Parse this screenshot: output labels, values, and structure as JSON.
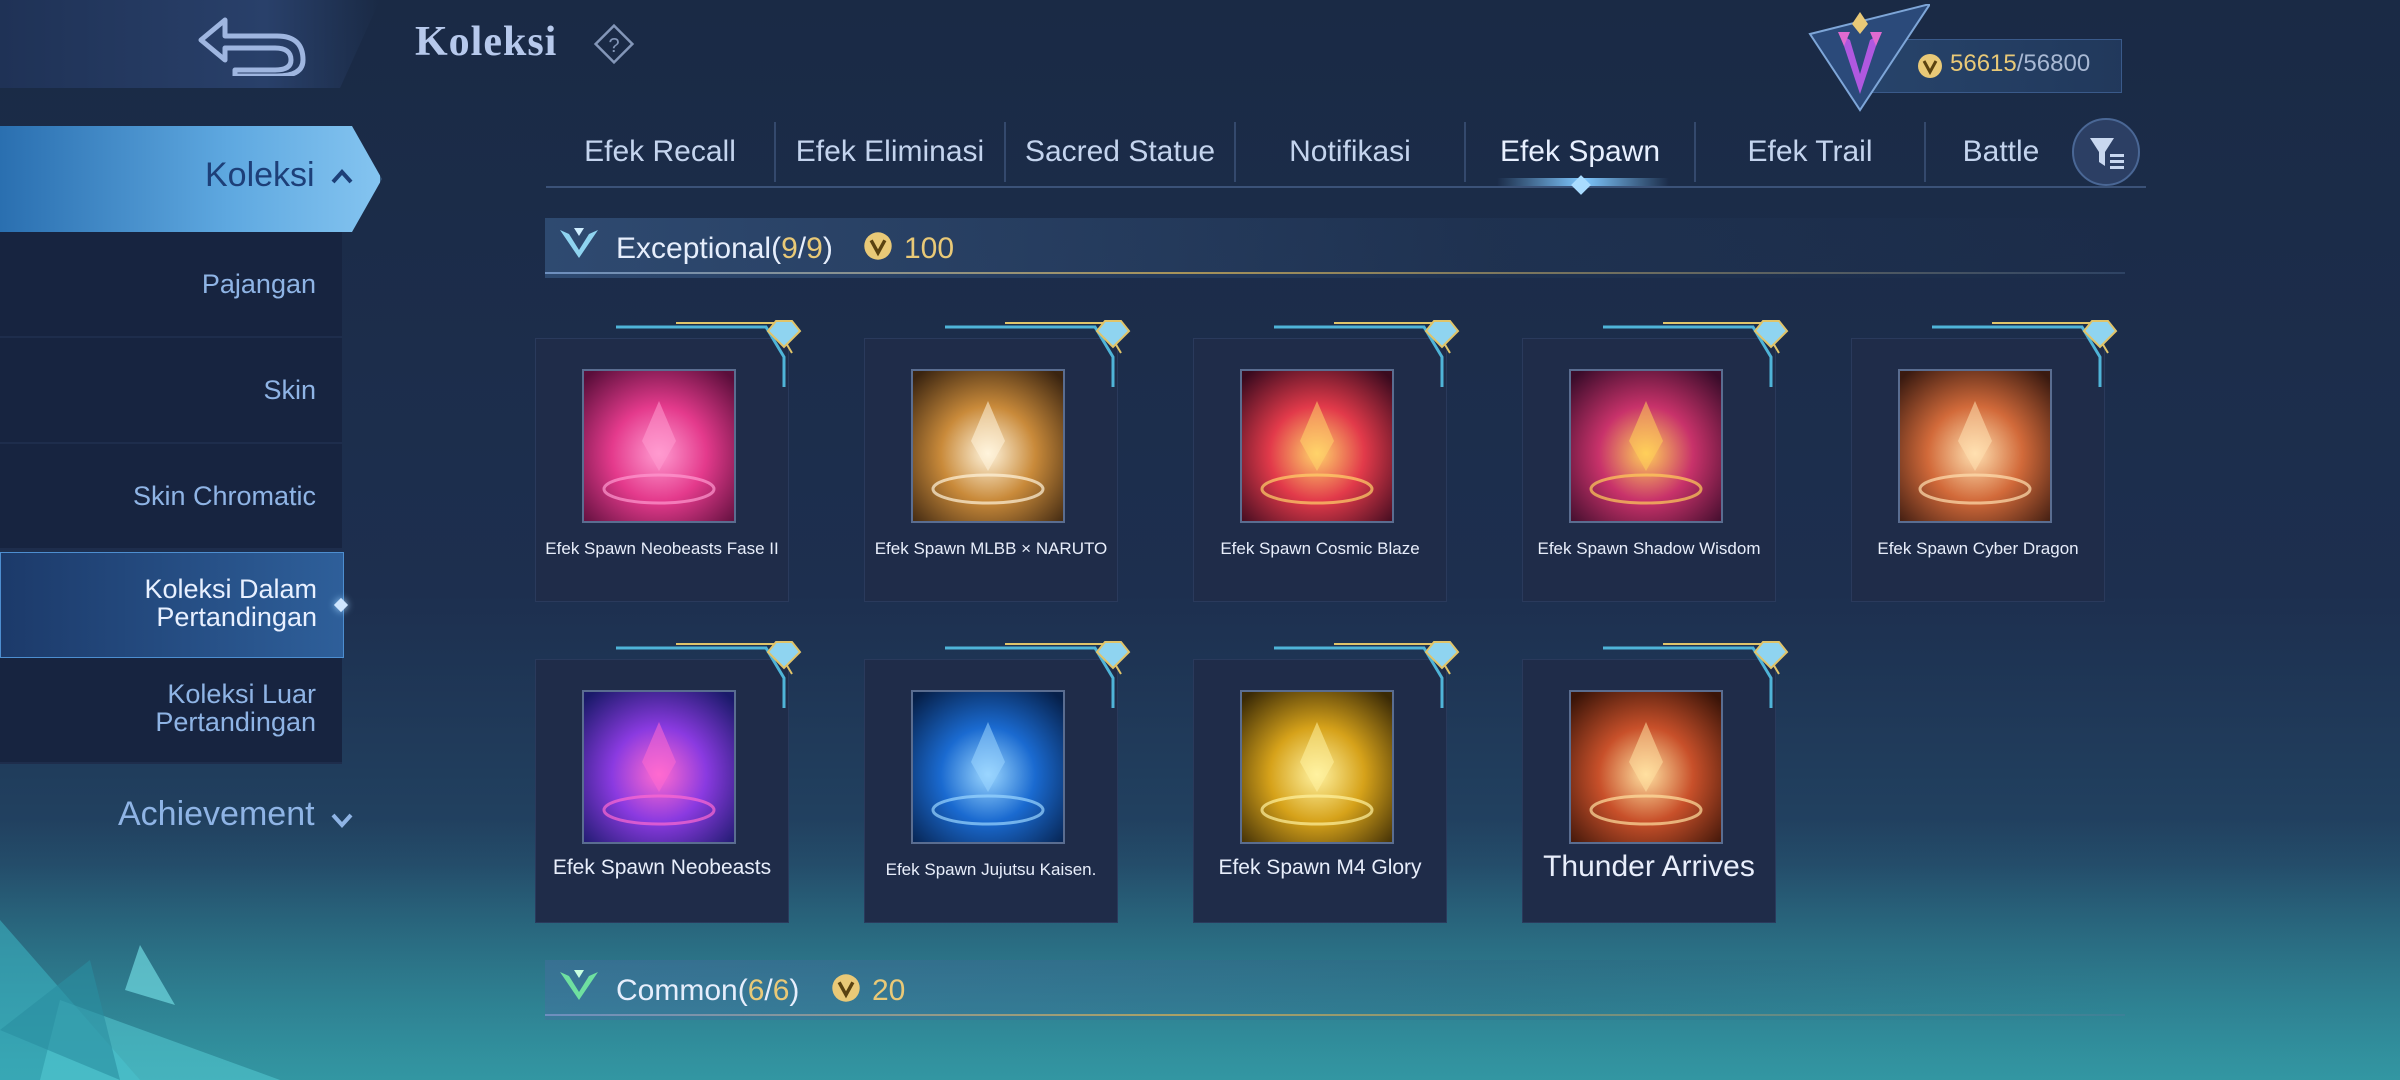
{
  "header": {
    "title": "Koleksi",
    "help_icon": "question-diamond-icon",
    "back_icon": "u-turn-back-arrow-icon",
    "currency": {
      "icon": "collector-coin-icon",
      "current": "56615",
      "separator": "/",
      "max": "56800"
    },
    "rank_icon": "purple-rank-emblem-icon"
  },
  "sidebar": {
    "main": {
      "label": "Koleksi",
      "icon": "chevron-up-icon"
    },
    "items": [
      {
        "label": "Pajangan",
        "active": false
      },
      {
        "label": "Skin",
        "active": false
      },
      {
        "label": "Skin Chromatic",
        "active": false
      },
      {
        "label": "Koleksi Dalam Pertandingan",
        "line1": "Koleksi Dalam",
        "line2": "Pertandingan",
        "active": true
      },
      {
        "label": "Koleksi Luar Pertandingan",
        "line1": "Koleksi Luar",
        "line2": "Pertandingan",
        "active": false
      }
    ],
    "achievement": {
      "label": "Achievement",
      "icon": "chevron-down-icon"
    }
  },
  "tabs": [
    {
      "label": "Efek Recall"
    },
    {
      "label": "Efek Eliminasi"
    },
    {
      "label": "Sacred Statue"
    },
    {
      "label": "Notifikasi"
    },
    {
      "label": "Efek Spawn",
      "active": true
    },
    {
      "label": "Efek Trail"
    },
    {
      "label": "Battle"
    }
  ],
  "filter_icon": "filter-funnel-icon",
  "sections": [
    {
      "tier": "Exceptional",
      "open": "(",
      "count": "9",
      "slash": "/",
      "total": "9",
      "close": ")",
      "reward": "100",
      "icon": "blue-chevron-tier-icon"
    },
    {
      "tier": "Common",
      "open": "(",
      "count": "6",
      "slash": "/",
      "total": "6",
      "close": ")",
      "reward": "20",
      "icon": "green-chevron-tier-icon"
    }
  ],
  "items": [
    {
      "name": "Efek Spawn Neobeasts Fase II",
      "icon": "neobeasts-phase-ii-spawn-icon",
      "colors": [
        "#5a0e3a",
        "#e43a8c",
        "#ff9ad0"
      ]
    },
    {
      "name": "Efek Spawn MLBB × NARUTO",
      "icon": "naruto-smoke-spawn-icon",
      "colors": [
        "#3a2410",
        "#c98a3a",
        "#fff4dc"
      ]
    },
    {
      "name": "Efek Spawn Cosmic Blaze",
      "icon": "cosmic-blaze-spawn-icon",
      "colors": [
        "#3a0a1e",
        "#e23a4a",
        "#ffd36a"
      ]
    },
    {
      "name": "Efek Spawn Shadow Wisdom",
      "icon": "shadow-wisdom-spawn-icon",
      "colors": [
        "#3a0c2a",
        "#c8326a",
        "#ffcf5a"
      ]
    },
    {
      "name": "Efek Spawn Cyber Dragon",
      "icon": "cyber-dragon-spawn-icon",
      "colors": [
        "#3a1a10",
        "#d26a3a",
        "#ffe0b0"
      ]
    },
    {
      "name": "Efek Spawn Neobeasts",
      "icon": "neobeasts-card-spawn-icon",
      "colors": [
        "#1a1a6a",
        "#8a3ae0",
        "#ff6ad0"
      ]
    },
    {
      "name": "Efek Spawn Jujutsu Kaisen.",
      "icon": "jujutsu-kaisen-orb-spawn-icon",
      "colors": [
        "#06204a",
        "#1a6ad0",
        "#9ad6ff"
      ]
    },
    {
      "name": "Efek Spawn M4 Glory",
      "icon": "m4-glory-light-spawn-icon",
      "colors": [
        "#3a2a06",
        "#d6a21a",
        "#fff2a0"
      ]
    },
    {
      "name": "Thunder Arrives",
      "icon": "thunder-bolt-spawn-icon",
      "colors": [
        "#3a1408",
        "#c8502a",
        "#ffe0a0"
      ]
    }
  ]
}
